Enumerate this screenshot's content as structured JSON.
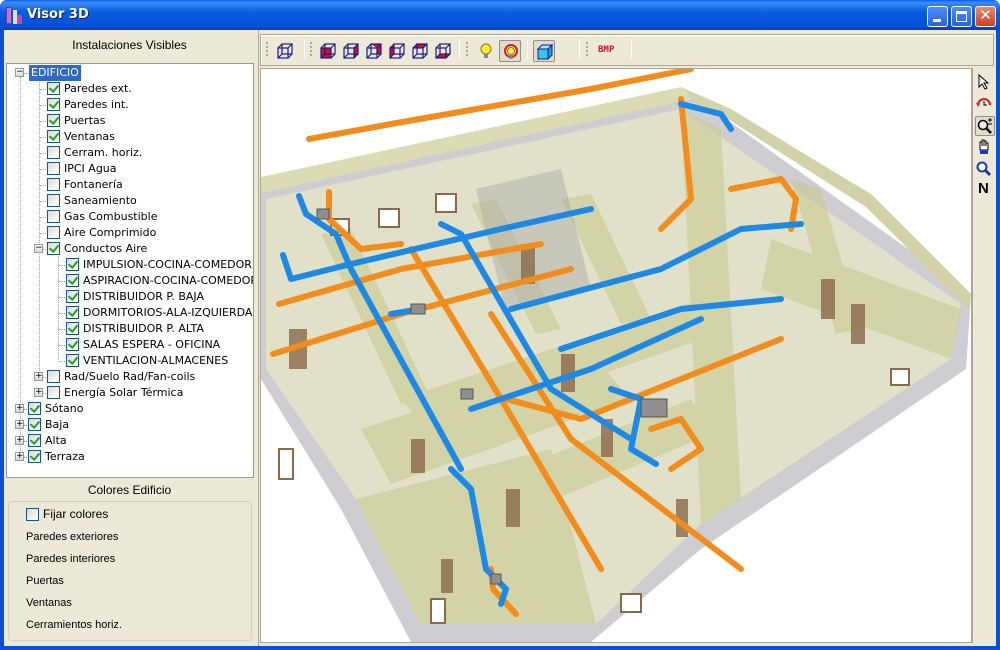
{
  "window": {
    "title": "Visor 3D",
    "controls": {
      "minimize": "minimize",
      "maximize": "maximize",
      "close": "✕"
    }
  },
  "left_panel": {
    "header": "Instalaciones Visibles",
    "tree": [
      {
        "label": "EDIFICIO",
        "level": 0,
        "expander": "minus",
        "checkbox": null,
        "selected": true
      },
      {
        "label": "Paredes ext.",
        "level": 1,
        "checked": true
      },
      {
        "label": "Paredes int.",
        "level": 1,
        "checked": true
      },
      {
        "label": "Puertas",
        "level": 1,
        "checked": true
      },
      {
        "label": "Ventanas",
        "level": 1,
        "checked": true
      },
      {
        "label": "Cerram. horiz.",
        "level": 1,
        "checked": false
      },
      {
        "label": "IPCI Agua",
        "level": 1,
        "checked": false
      },
      {
        "label": "Fontanería",
        "level": 1,
        "checked": false
      },
      {
        "label": "Saneamiento",
        "level": 1,
        "checked": false
      },
      {
        "label": "Gas Combustible",
        "level": 1,
        "checked": false
      },
      {
        "label": "Aire Comprimido",
        "level": 1,
        "checked": false
      },
      {
        "label": "Conductos Aire",
        "level": 1,
        "checked": true,
        "expander": "minus"
      },
      {
        "label": "IMPULSION-COCINA-COMEDOR",
        "level": 2,
        "checked": true
      },
      {
        "label": "ASPIRACION-COCINA-COMEDOR",
        "level": 2,
        "checked": true
      },
      {
        "label": "DISTRIBUIDOR P. BAJA",
        "level": 2,
        "checked": true
      },
      {
        "label": "DORMITORIOS-ALA-IZQUIERDA",
        "level": 2,
        "checked": true
      },
      {
        "label": "DISTRIBUIDOR P. ALTA",
        "level": 2,
        "checked": true
      },
      {
        "label": "SALAS ESPERA - OFICINA",
        "level": 2,
        "checked": true
      },
      {
        "label": "VENTILACION-ALMACENES",
        "level": 2,
        "checked": true
      },
      {
        "label": "Rad/Suelo Rad/Fan-coils",
        "level": 1,
        "checked": false,
        "expander": "plus"
      },
      {
        "label": "Energía Solar Térmica",
        "level": 1,
        "checked": false,
        "expander": "plus"
      },
      {
        "label": "Sótano",
        "level": 0,
        "checked": true,
        "expander": "plus"
      },
      {
        "label": "Baja",
        "level": 0,
        "checked": true,
        "expander": "plus"
      },
      {
        "label": "Alta",
        "level": 0,
        "checked": true,
        "expander": "plus"
      },
      {
        "label": "Terraza",
        "level": 0,
        "checked": true,
        "expander": "plus"
      }
    ],
    "colors_header": "Colores Edificio",
    "fix_colors": {
      "label": "Fijar colores",
      "checked": false
    },
    "color_items": [
      "Paredes exteriores",
      "Paredes interiores",
      "Puertas",
      "Ventanas",
      "Cerramientos horiz."
    ]
  },
  "toolbar": {
    "groups": [
      {
        "tools": [
          "view-3d-cube"
        ]
      },
      {
        "tools": [
          "view-face-front",
          "view-face-right",
          "view-face-top-right",
          "view-face-left",
          "view-face-top",
          "view-face-bottom"
        ]
      },
      {
        "tools": [
          "light-bulb",
          "light-rotate",
          "shaded-cube"
        ],
        "pressed": [
          "light-rotate",
          "shaded-cube"
        ]
      },
      {
        "tools": [
          "export-bmp"
        ]
      }
    ],
    "bmp_label": "BMP"
  },
  "side_toolbar": {
    "tools": [
      "select-pointer",
      "orbit-rotate",
      "zoom-in-out",
      "pan-hand",
      "zoom-window",
      "north"
    ],
    "pressed": "zoom-in-out",
    "north_label": "N"
  },
  "viewport": {
    "description": "3D building model with air duct installations",
    "colors": {
      "walls": "#c8c89a",
      "exterior": "#c7c7cb",
      "duct_blue": "#1e88e5",
      "duct_orange": "#f28c1c",
      "doors": "#8a6a4a"
    }
  }
}
